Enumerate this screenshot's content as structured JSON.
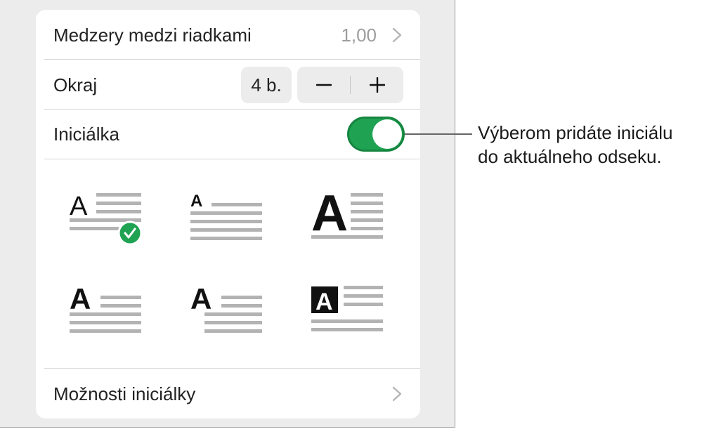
{
  "panel": {
    "line_spacing": {
      "label": "Medzery medzi riadkami",
      "value": "1,00",
      "icon": "chevron-right-icon"
    },
    "margin": {
      "label": "Okraj",
      "value": "4 b.",
      "decrement_icon": "minus-icon",
      "increment_icon": "plus-icon"
    },
    "drop_cap": {
      "label": "Iniciálka",
      "enabled": true
    },
    "styles": [
      {
        "letter": "A",
        "selected": true
      },
      {
        "letter": "A",
        "selected": false
      },
      {
        "letter": "A",
        "selected": false
      },
      {
        "letter": "A",
        "selected": false
      },
      {
        "letter": "A",
        "selected": false
      },
      {
        "letter": "A",
        "selected": false
      }
    ],
    "options": {
      "label": "Možnosti iniciálky",
      "icon": "chevron-right-icon"
    }
  },
  "callout": {
    "line1": "Výberom pridáte iniciálu",
    "line2": "do aktuálneho odseku."
  },
  "colors": {
    "accent": "#1fa352",
    "text": "#222222",
    "secondary_text": "#9d9d9d",
    "panel_bg": "#ececec",
    "lines": "#b3b3b3"
  }
}
